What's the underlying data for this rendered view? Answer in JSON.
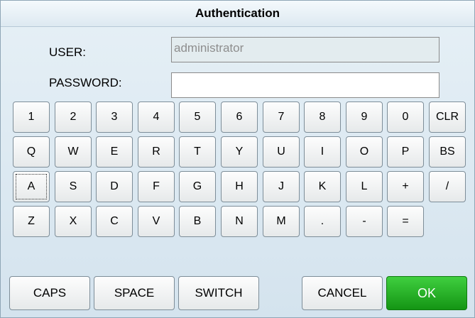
{
  "dialog": {
    "title": "Authentication"
  },
  "form": {
    "user_label": "USER:",
    "user_value": "administrator",
    "password_label": "PASSWORD:",
    "password_value": ""
  },
  "keyboard": {
    "row1": [
      "1",
      "2",
      "3",
      "4",
      "5",
      "6",
      "7",
      "8",
      "9",
      "0",
      "CLR"
    ],
    "row2": [
      "Q",
      "W",
      "E",
      "R",
      "T",
      "Y",
      "U",
      "I",
      "O",
      "P",
      "BS"
    ],
    "row3": [
      "A",
      "S",
      "D",
      "F",
      "G",
      "H",
      "J",
      "K",
      "L",
      "+",
      "/"
    ],
    "row4": [
      "Z",
      "X",
      "C",
      "V",
      "B",
      "N",
      "M",
      ".",
      "-",
      "="
    ],
    "focused_key": "A"
  },
  "actions": {
    "caps": "CAPS",
    "space": "SPACE",
    "switch": "SWITCH",
    "cancel": "CANCEL",
    "ok": "OK"
  },
  "colors": {
    "ok_button": "#22b022",
    "readonly_field": "#e3ecef"
  }
}
